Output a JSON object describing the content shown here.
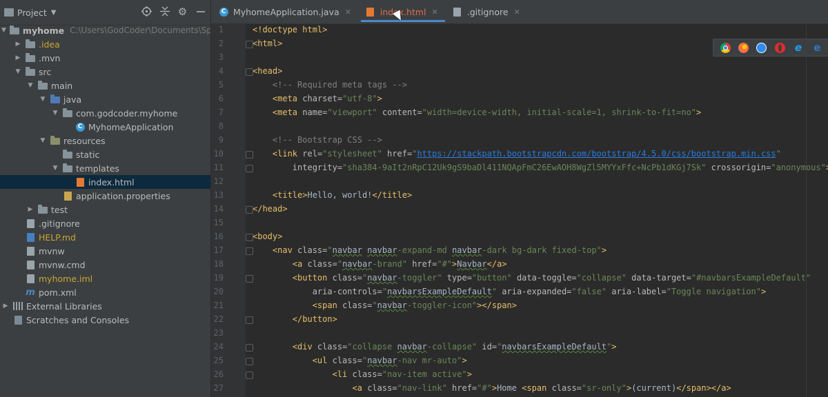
{
  "project_panel": {
    "title": "Project",
    "tree": [
      {
        "label": "myhome",
        "hint": "C:\\Users\\GodCoder\\Documents\\Spr",
        "level": 0,
        "expanded": true,
        "icon": "folder-icon",
        "style": "bold"
      },
      {
        "label": ".idea",
        "level": 1,
        "expanded": false,
        "icon": "folder-icon",
        "style": "gold"
      },
      {
        "label": ".mvn",
        "level": 1,
        "expanded": false,
        "icon": "folder-icon"
      },
      {
        "label": "src",
        "level": 1,
        "expanded": true,
        "icon": "folder-icon"
      },
      {
        "label": "main",
        "level": 2,
        "expanded": true,
        "icon": "folder-icon"
      },
      {
        "label": "java",
        "level": 3,
        "expanded": true,
        "icon": "source-folder-icon"
      },
      {
        "label": "com.godcoder.myhome",
        "level": 4,
        "expanded": true,
        "icon": "package-icon"
      },
      {
        "label": "MyhomeApplication",
        "level": 5,
        "icon": "spring-class-icon"
      },
      {
        "label": "resources",
        "level": 3,
        "expanded": true,
        "icon": "resources-folder-icon"
      },
      {
        "label": "static",
        "level": 4,
        "icon": "folder-icon"
      },
      {
        "label": "templates",
        "level": 4,
        "expanded": true,
        "icon": "folder-icon"
      },
      {
        "label": "index.html",
        "level": 5,
        "icon": "html-file-icon",
        "selected": true
      },
      {
        "label": "application.properties",
        "level": 4,
        "icon": "properties-file-icon"
      },
      {
        "label": "test",
        "level": 2,
        "expanded": false,
        "icon": "folder-icon"
      },
      {
        "label": ".gitignore",
        "level": 1,
        "icon": "gitignore-file-icon"
      },
      {
        "label": "HELP.md",
        "level": 1,
        "icon": "markdown-file-icon",
        "style": "gold"
      },
      {
        "label": "mvnw",
        "level": 1,
        "icon": "script-file-icon"
      },
      {
        "label": "mvnw.cmd",
        "level": 1,
        "icon": "text-file-icon"
      },
      {
        "label": "myhome.iml",
        "level": 1,
        "icon": "iml-file-icon",
        "style": "gold"
      },
      {
        "label": "pom.xml",
        "level": 1,
        "icon": "maven-file-icon"
      },
      {
        "label": "External Libraries",
        "level": 0,
        "expanded": false,
        "icon": "library-icon"
      },
      {
        "label": "Scratches and Consoles",
        "level": 0,
        "icon": "scratches-icon"
      }
    ]
  },
  "tabs": [
    {
      "label": "MyhomeApplication.java",
      "icon": "spring-class-icon",
      "active": false,
      "closable": true
    },
    {
      "label": "index.html",
      "icon": "html-file-icon",
      "active": true,
      "closable": true
    },
    {
      "label": ".gitignore",
      "icon": "gitignore-file-icon",
      "active": false,
      "closable": true
    }
  ],
  "browsers": [
    "chrome-icon",
    "firefox-icon",
    "safari-icon",
    "opera-icon",
    "ie-icon",
    "edge-icon"
  ],
  "editor": {
    "lines": [
      {
        "n": "1",
        "t": [
          [
            "tag",
            "<!doctype html>"
          ]
        ]
      },
      {
        "n": "2",
        "t": [
          [
            "tag",
            "<html>"
          ]
        ],
        "fold": true
      },
      {
        "n": "3",
        "t": []
      },
      {
        "n": "4",
        "t": [
          [
            "tag",
            "<head>"
          ]
        ],
        "fold": true
      },
      {
        "n": "5",
        "t": [
          [
            "cmt",
            "    <!-- Required meta tags -->"
          ]
        ]
      },
      {
        "n": "6",
        "t": [
          [
            "plain",
            "    "
          ],
          [
            "tag",
            "<meta "
          ],
          [
            "attr",
            "charset="
          ],
          [
            "val",
            "\"utf-8\""
          ],
          [
            "tag",
            ">"
          ]
        ]
      },
      {
        "n": "7",
        "t": [
          [
            "plain",
            "    "
          ],
          [
            "tag",
            "<meta "
          ],
          [
            "attr",
            "name="
          ],
          [
            "val",
            "\"viewport\" "
          ],
          [
            "attr",
            "content="
          ],
          [
            "val",
            "\"width=device-width, initial-scale=1, shrink-to-fit=no\""
          ],
          [
            "tag",
            ">"
          ]
        ]
      },
      {
        "n": "8",
        "t": []
      },
      {
        "n": "9",
        "t": [
          [
            "cmt",
            "    <!-- Bootstrap CSS -->"
          ]
        ]
      },
      {
        "n": "10",
        "t": [
          [
            "plain",
            "    "
          ],
          [
            "tag",
            "<link "
          ],
          [
            "attr",
            "rel="
          ],
          [
            "val",
            "\"stylesheet\" "
          ],
          [
            "attr",
            "href="
          ],
          [
            "val",
            "\""
          ],
          [
            "url",
            "https://stackpath.bootstrapcdn.com/bootstrap/4.5.0/css/bootstrap.min.css"
          ],
          [
            "val",
            "\""
          ]
        ],
        "fold": true
      },
      {
        "n": "11",
        "t": [
          [
            "plain",
            "        "
          ],
          [
            "attr",
            "integrity="
          ],
          [
            "val",
            "\"sha384-9aIt2nRpC12Uk9gS9baDl411NQApFmC26EwAOH8WgZl5MYYxFfc+NcPb1dKGj7Sk\" "
          ],
          [
            "attr",
            "crossorigin="
          ],
          [
            "val",
            "\"anonymous\""
          ],
          [
            "tag",
            ">"
          ]
        ],
        "fold": true
      },
      {
        "n": "12",
        "t": []
      },
      {
        "n": "13",
        "t": [
          [
            "plain",
            "    "
          ],
          [
            "tag",
            "<title>"
          ],
          [
            "ent",
            "Hello, world!"
          ],
          [
            "tag",
            "</title>"
          ]
        ]
      },
      {
        "n": "14",
        "t": [
          [
            "tag",
            "</head>"
          ]
        ],
        "fold": true
      },
      {
        "n": "15",
        "t": []
      },
      {
        "n": "16",
        "t": [
          [
            "tag",
            "<body>"
          ]
        ],
        "fold": true
      },
      {
        "n": "17",
        "t": [
          [
            "plain",
            "    "
          ],
          [
            "tag",
            "<nav "
          ],
          [
            "attr",
            "class="
          ],
          [
            "val",
            "\""
          ],
          [
            "typo",
            "navbar"
          ],
          [
            "val",
            " "
          ],
          [
            "typo",
            "navbar"
          ],
          [
            "val",
            "-expand-md "
          ],
          [
            "typo",
            "navbar"
          ],
          [
            "val",
            "-dark bg-dark fixed-top\""
          ],
          [
            "tag",
            ">"
          ]
        ],
        "fold": true
      },
      {
        "n": "18",
        "t": [
          [
            "plain",
            "        "
          ],
          [
            "tag",
            "<a "
          ],
          [
            "attr",
            "class="
          ],
          [
            "val",
            "\""
          ],
          [
            "typo",
            "navbar"
          ],
          [
            "val",
            "-brand\" "
          ],
          [
            "attr",
            "href="
          ],
          [
            "val",
            "\"#\""
          ],
          [
            "tag",
            ">"
          ],
          [
            "typo",
            "Navbar"
          ],
          [
            "tag",
            "</a>"
          ]
        ]
      },
      {
        "n": "19",
        "t": [
          [
            "plain",
            "        "
          ],
          [
            "tag",
            "<button "
          ],
          [
            "attr",
            "class="
          ],
          [
            "val",
            "\""
          ],
          [
            "typo",
            "navbar"
          ],
          [
            "val",
            "-toggler\" "
          ],
          [
            "attr",
            "type="
          ],
          [
            "val",
            "\"button\" "
          ],
          [
            "attr",
            "data-toggle="
          ],
          [
            "val",
            "\"collapse\" "
          ],
          [
            "attr",
            "data-target="
          ],
          [
            "val",
            "\"#navbarsExampleDefault\""
          ]
        ],
        "fold": true
      },
      {
        "n": "20",
        "t": [
          [
            "plain",
            "            "
          ],
          [
            "attr",
            "aria-controls="
          ],
          [
            "val",
            "\""
          ],
          [
            "typo",
            "navbarsExampleDefault"
          ],
          [
            "val",
            "\" "
          ],
          [
            "attr",
            "aria-expanded="
          ],
          [
            "val",
            "\"false\" "
          ],
          [
            "attr",
            "aria-label="
          ],
          [
            "val",
            "\"Toggle navigation\""
          ],
          [
            "tag",
            ">"
          ]
        ]
      },
      {
        "n": "21",
        "t": [
          [
            "plain",
            "            "
          ],
          [
            "tag",
            "<span "
          ],
          [
            "attr",
            "class="
          ],
          [
            "val",
            "\""
          ],
          [
            "typo",
            "navbar"
          ],
          [
            "val",
            "-toggler-icon\""
          ],
          [
            "tag",
            "></span>"
          ]
        ]
      },
      {
        "n": "22",
        "t": [
          [
            "plain",
            "        "
          ],
          [
            "tag",
            "</button>"
          ]
        ],
        "fold": true
      },
      {
        "n": "23",
        "t": []
      },
      {
        "n": "24",
        "t": [
          [
            "plain",
            "        "
          ],
          [
            "tag",
            "<div "
          ],
          [
            "attr",
            "class="
          ],
          [
            "val",
            "\"collapse "
          ],
          [
            "typo",
            "navbar"
          ],
          [
            "val",
            "-collapse\" "
          ],
          [
            "attr",
            "id="
          ],
          [
            "val",
            "\""
          ],
          [
            "typo",
            "navbarsExampleDefault"
          ],
          [
            "val",
            "\""
          ],
          [
            "tag",
            ">"
          ]
        ],
        "fold": true
      },
      {
        "n": "25",
        "t": [
          [
            "plain",
            "            "
          ],
          [
            "tag",
            "<ul "
          ],
          [
            "attr",
            "class="
          ],
          [
            "val",
            "\""
          ],
          [
            "typo",
            "navbar"
          ],
          [
            "val",
            "-nav mr-auto\""
          ],
          [
            "tag",
            ">"
          ]
        ],
        "fold": true
      },
      {
        "n": "26",
        "t": [
          [
            "plain",
            "                "
          ],
          [
            "tag",
            "<li "
          ],
          [
            "attr",
            "class="
          ],
          [
            "val",
            "\"nav-item active\""
          ],
          [
            "tag",
            ">"
          ]
        ],
        "fold": true
      },
      {
        "n": "27",
        "t": [
          [
            "plain",
            "                    "
          ],
          [
            "tag",
            "<a "
          ],
          [
            "attr",
            "class="
          ],
          [
            "val",
            "\"nav-link\" "
          ],
          [
            "attr",
            "href="
          ],
          [
            "val",
            "\"#\""
          ],
          [
            "tag",
            ">"
          ],
          [
            "ent",
            "Home "
          ],
          [
            "tag",
            "<span "
          ],
          [
            "attr",
            "class="
          ],
          [
            "val",
            "\"sr-only\""
          ],
          [
            "tag",
            ">"
          ],
          [
            "ent",
            "(current)"
          ],
          [
            "tag",
            "</span></a>"
          ]
        ]
      }
    ]
  }
}
